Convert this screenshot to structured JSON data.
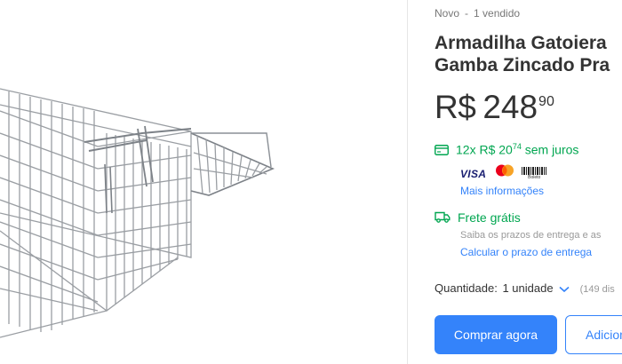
{
  "product": {
    "condition": "Novo",
    "separator": "-",
    "sold": "1 vendido",
    "title_line1": "Armadilha Gatoiera",
    "title_line2": "Gamba Zincado Pra",
    "price": {
      "currency": "R$",
      "integer": "248",
      "cents": "90"
    },
    "installments": {
      "prefix": "12x R$ 20",
      "cents": "74",
      "suffix": "sem juros"
    },
    "payment_methods": {
      "visa": "VISA",
      "boleto": "Boleto"
    },
    "more_info_link": "Mais informações",
    "shipping": {
      "title": "Frete grátis",
      "subtitle": "Saiba os prazos de entrega e as",
      "calc_link": "Calcular o prazo de entrega"
    },
    "quantity": {
      "label": "Quantidade:",
      "value": "1 unidade",
      "available": "(149 dis"
    },
    "buttons": {
      "buy": "Comprar agora",
      "add": "Adicion"
    }
  },
  "colors": {
    "primary": "#3483fa",
    "success": "#00a650",
    "text": "#333333",
    "muted": "#999999"
  },
  "icons": {
    "card": "credit-card-icon",
    "truck": "truck-icon",
    "chevron": "chevron-down-icon"
  }
}
